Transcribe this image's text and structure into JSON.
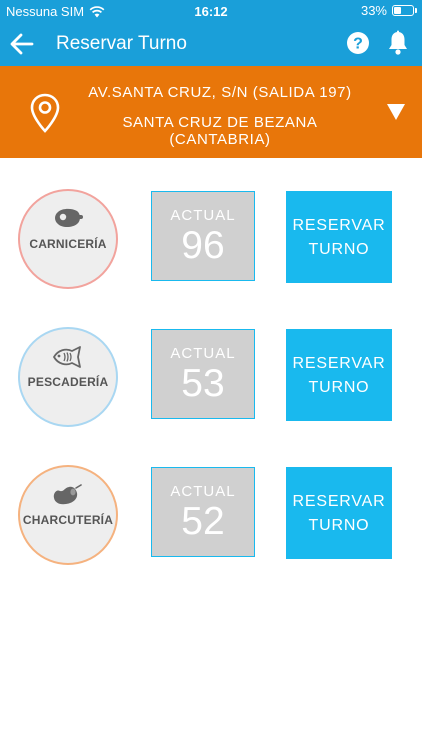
{
  "status": {
    "carrier": "Nessuna SIM",
    "time": "16:12",
    "battery": "33%",
    "battery_level": 0.33
  },
  "header": {
    "title": "Reservar Turno",
    "back_icon": "arrow-left-icon",
    "help_icon": "question-circle-icon",
    "notifications_icon": "bell-icon"
  },
  "location": {
    "address": "AV.SANTA CRUZ, S/N (SALIDA 197)",
    "city": "SANTA CRUZ DE BEZANA (CANTABRIA)",
    "icon": "map-pin-icon",
    "dropdown_icon": "caret-down-icon"
  },
  "colors": {
    "header": "#1a9fd9",
    "location_bar": "#e8760a",
    "reserve_button": "#19b9ee",
    "actual_box": "#d0d0d0",
    "carniceria_border": "#f2a39d",
    "pescaderia_border": "#a9d7f2",
    "charcuteria_border": "#f5b27f"
  },
  "departments": [
    {
      "name": "CARNICERÍA",
      "icon": "meat-icon",
      "actual_label": "ACTUAL",
      "actual": "96",
      "reserve_line1": "RESERVAR",
      "reserve_line2": "TURNO"
    },
    {
      "name": "PESCADERÍA",
      "icon": "fish-icon",
      "actual_label": "ACTUAL",
      "actual": "53",
      "reserve_line1": "RESERVAR",
      "reserve_line2": "TURNO"
    },
    {
      "name": "CHARCUTERÍA",
      "icon": "sausage-icon",
      "actual_label": "ACTUAL",
      "actual": "52",
      "reserve_line1": "RESERVAR",
      "reserve_line2": "TURNO"
    }
  ]
}
